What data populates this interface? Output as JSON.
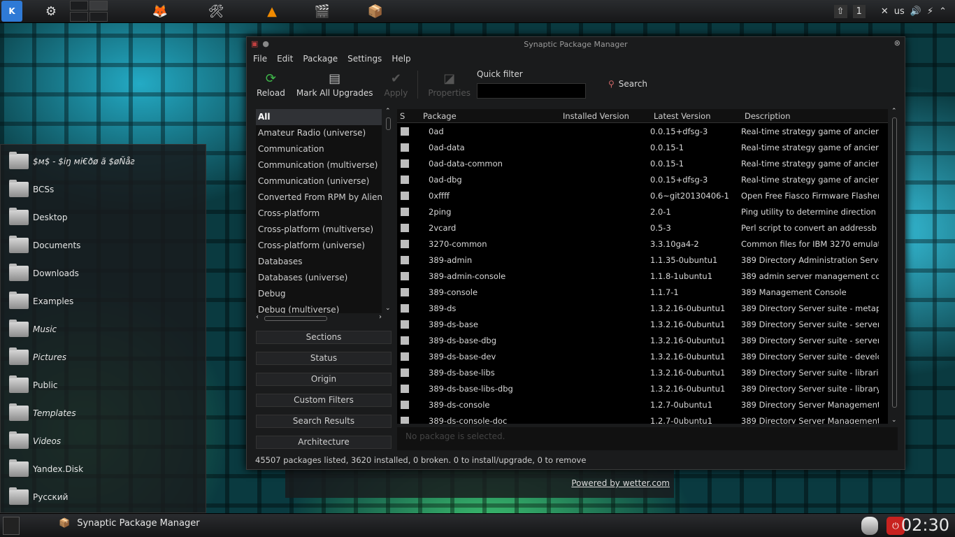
{
  "topbar": {
    "launcher_glyph": "K",
    "tray_keyboard": "us",
    "tray_desktop_number": "1"
  },
  "places": [
    {
      "label": "$м$ - $іŋ мі€ðø ã $øÑåƨ",
      "italic": true
    },
    {
      "label": "BCSs",
      "italic": false
    },
    {
      "label": "Desktop",
      "italic": false
    },
    {
      "label": "Documents",
      "italic": false
    },
    {
      "label": "Downloads",
      "italic": false
    },
    {
      "label": "Examples",
      "italic": false
    },
    {
      "label": "Music",
      "italic": true
    },
    {
      "label": "Pictures",
      "italic": true
    },
    {
      "label": "Public",
      "italic": false
    },
    {
      "label": "Templates",
      "italic": true
    },
    {
      "label": "Videos",
      "italic": true
    },
    {
      "label": "Yandex.Disk",
      "italic": false
    },
    {
      "label": "Русский",
      "italic": false
    }
  ],
  "weather_link": "Powered by wetter.com",
  "window": {
    "title": "Synaptic Package Manager",
    "menu": [
      "File",
      "Edit",
      "Package",
      "Settings",
      "Help"
    ],
    "toolbar": {
      "reload": "Reload",
      "mark_all": "Mark All Upgrades",
      "apply": "Apply",
      "properties": "Properties",
      "quick_filter": "Quick filter",
      "search": "Search"
    },
    "categories": [
      "All",
      "Amateur Radio (universe)",
      "Communication",
      "Communication (multiverse)",
      "Communication (universe)",
      "Converted From RPM by Alien",
      "Cross-platform",
      "Cross-platform (multiverse)",
      "Cross-platform (universe)",
      "Databases",
      "Databases (universe)",
      "Debug",
      "Debug (multiverse)"
    ],
    "filter_buttons": [
      "Sections",
      "Status",
      "Origin",
      "Custom Filters",
      "Search Results",
      "Architecture"
    ],
    "columns": {
      "status": "S",
      "package": "Package",
      "installed": "Installed Version",
      "latest": "Latest Version",
      "description": "Description"
    },
    "packages": [
      {
        "name": "0ad",
        "installed": "",
        "latest": "0.0.15+dfsg-3",
        "desc": "Real-time strategy game of ancier"
      },
      {
        "name": "0ad-data",
        "installed": "",
        "latest": "0.0.15-1",
        "desc": "Real-time strategy game of ancier"
      },
      {
        "name": "0ad-data-common",
        "installed": "",
        "latest": "0.0.15-1",
        "desc": "Real-time strategy game of ancier"
      },
      {
        "name": "0ad-dbg",
        "installed": "",
        "latest": "0.0.15+dfsg-3",
        "desc": "Real-time strategy game of ancier"
      },
      {
        "name": "0xffff",
        "installed": "",
        "latest": "0.6~git20130406-1",
        "desc": "Open Free Fiasco Firmware Flasher"
      },
      {
        "name": "2ping",
        "installed": "",
        "latest": "2.0-1",
        "desc": "Ping utility to determine direction"
      },
      {
        "name": "2vcard",
        "installed": "",
        "latest": "0.5-3",
        "desc": "Perl script to convert an addressb"
      },
      {
        "name": "3270-common",
        "installed": "",
        "latest": "3.3.10ga4-2",
        "desc": "Common files for IBM 3270 emulat"
      },
      {
        "name": "389-admin",
        "installed": "",
        "latest": "1.1.35-0ubuntu1",
        "desc": "389 Directory Administration Serve"
      },
      {
        "name": "389-admin-console",
        "installed": "",
        "latest": "1.1.8-1ubuntu1",
        "desc": "389 admin server management co"
      },
      {
        "name": "389-console",
        "installed": "",
        "latest": "1.1.7-1",
        "desc": "389 Management Console"
      },
      {
        "name": "389-ds",
        "installed": "",
        "latest": "1.3.2.16-0ubuntu1",
        "desc": "389 Directory Server suite - metap"
      },
      {
        "name": "389-ds-base",
        "installed": "",
        "latest": "1.3.2.16-0ubuntu1",
        "desc": "389 Directory Server suite - server"
      },
      {
        "name": "389-ds-base-dbg",
        "installed": "",
        "latest": "1.3.2.16-0ubuntu1",
        "desc": "389 Directory Server suite - server"
      },
      {
        "name": "389-ds-base-dev",
        "installed": "",
        "latest": "1.3.2.16-0ubuntu1",
        "desc": "389 Directory Server suite - develo"
      },
      {
        "name": "389-ds-base-libs",
        "installed": "",
        "latest": "1.3.2.16-0ubuntu1",
        "desc": "389 Directory Server suite - librari"
      },
      {
        "name": "389-ds-base-libs-dbg",
        "installed": "",
        "latest": "1.3.2.16-0ubuntu1",
        "desc": "389 Directory Server suite - library"
      },
      {
        "name": "389-ds-console",
        "installed": "",
        "latest": "1.2.7-0ubuntu1",
        "desc": "389 Directory Server Management"
      },
      {
        "name": "389-ds-console-doc",
        "installed": "",
        "latest": "1.2.7-0ubuntu1",
        "desc": "389 Directory Server Management"
      }
    ],
    "detail_placeholder": "No package is selected.",
    "status": "45507 packages listed, 3620 installed, 0 broken. 0 to install/upgrade, 0 to remove"
  },
  "taskbar": {
    "task_label": "Synaptic Package Manager",
    "clock": "02:30"
  }
}
